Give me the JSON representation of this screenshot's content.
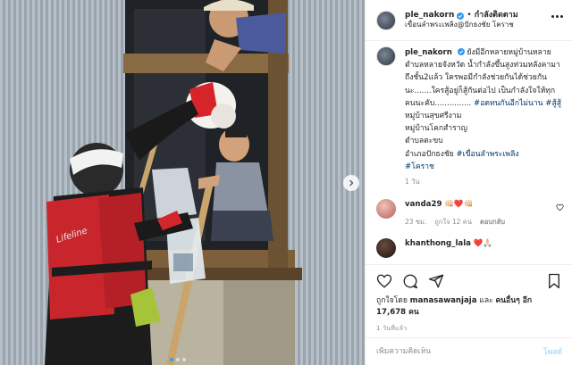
{
  "post": {
    "username": "ple_nakorn",
    "follow_separator": "•",
    "follow_label": "กำลังติดตาม",
    "location": "เขื่อนลำพระเพลิง@ปักธงชัย โคราช"
  },
  "caption": {
    "username": "ple_nakorn",
    "text": "ยังมีอีกหลายหมู่บ้านหลายตำบลหลายจังหวัด น้ำกำลังขึ้นสูงท่วมหลังคามาถึงชั้น2แล้ว ใครพอมีกำลังช่วยกันได้ช่วยกันนะ.......ใครสู้อยู่ก็สู้กันต่อไป เป็นกำลังใจให้ทุกคนนะคับ...............",
    "tags_line1": "#อดทนกันอีกไม่นาน #สู้สู้",
    "text2": "หมู่บ้านสุขศรีงาม\nหมู่บ้านโคกสำราญ\nตำบลตะขบ\nอำเภอปักธงชัย",
    "tags_line2": "#เขื่อนลำพระเพลิง",
    "tags_line3": "#โคราช",
    "time": "1 วัน"
  },
  "comments": [
    {
      "username": "vanda29",
      "text": "👊🏻❤️👊🏻",
      "time": "23 ชม.",
      "likes": "ถูกใจ 12 คน",
      "reply": "ตอบกลับ"
    },
    {
      "username": "khanthong_lala",
      "text": "❤️🙏🏻"
    }
  ],
  "actions": {
    "liked_by_prefix": "ถูกใจโดย",
    "liked_by_user": "manasawanjaja",
    "liked_by_and": "และ",
    "liked_by_others": "คนอื่นๆ อีก 17,678 คน",
    "date": "1 วันที่แล้ว"
  },
  "add_comment": {
    "placeholder": "เพิ่มความคิดเห็น",
    "post_label": "โพสต์"
  },
  "colors": {
    "link_blue": "#003569",
    "verified_blue": "#3897f0",
    "post_disabled": "#b2dffc",
    "muted": "#8e8e8e"
  },
  "icons": [
    "verified-icon",
    "more-icon",
    "heart-icon",
    "comment-icon",
    "share-icon",
    "save-icon",
    "chevron-right-icon"
  ]
}
